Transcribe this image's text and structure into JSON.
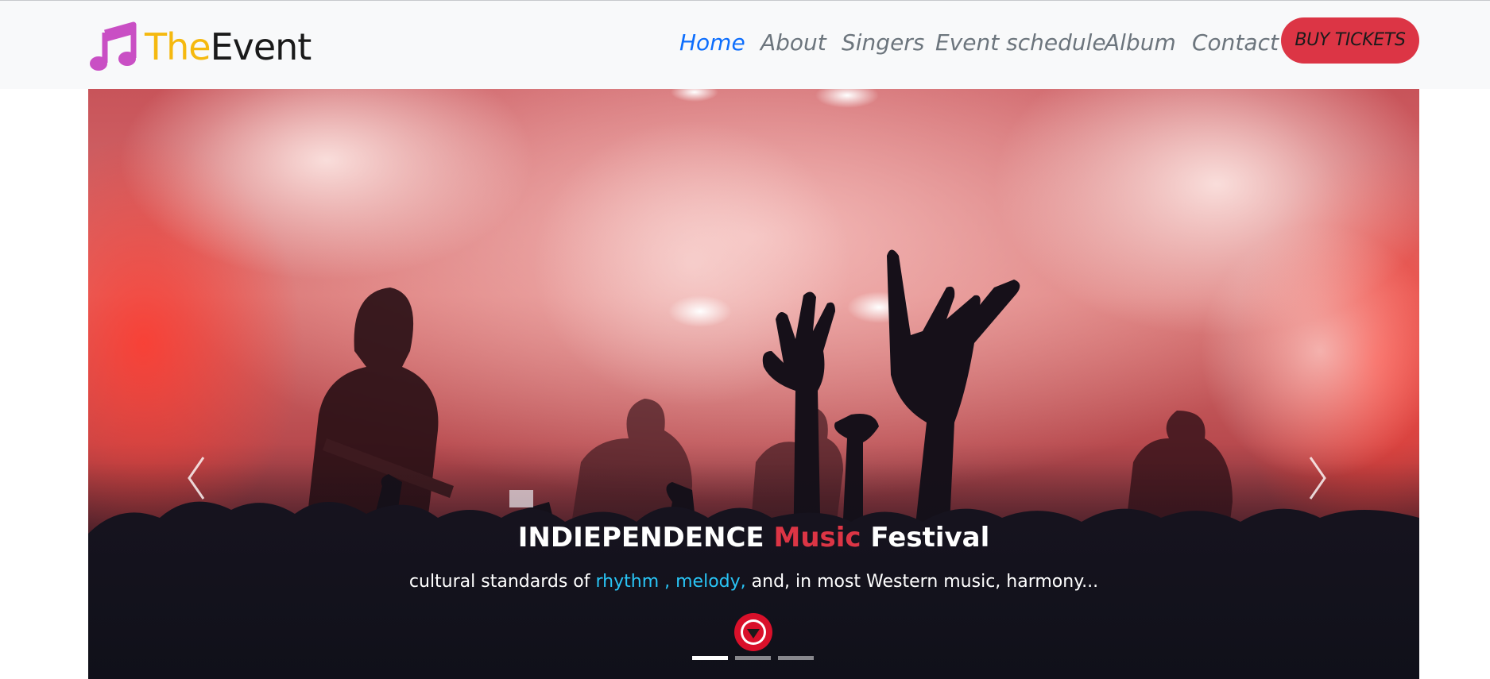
{
  "brand": {
    "part1": "The",
    "part2": "Event",
    "icon": "music-note-icon",
    "icon_color": "#c94fc4"
  },
  "nav": {
    "items": [
      {
        "label": "Home",
        "active": true
      },
      {
        "label": "About",
        "active": false
      },
      {
        "label": "Singers",
        "active": false
      },
      {
        "label": "Event schedule",
        "active": false
      },
      {
        "label": "Album",
        "active": false
      },
      {
        "label": "Contact",
        "active": false
      }
    ],
    "cta": "BUY TICKETS"
  },
  "hero": {
    "title": {
      "part1": "INDIEPENDENCE",
      "part2": "Music",
      "part3": "Festival"
    },
    "subtitle": {
      "part1": "cultural standards of",
      "part2": "rhythm , melody,",
      "part3": "and, in most Western music, harmony..."
    },
    "prev_icon": "chevron-left-icon",
    "next_icon": "chevron-right-icon",
    "scroll_icon": "triangle-down-icon",
    "slides": 3,
    "active_slide": 1
  },
  "colors": {
    "accent_red": "#dc3545",
    "link_active": "#0d6efd",
    "link": "#6c757d",
    "highlight_cyan": "#29c5f6",
    "brand_yellow": "#f5b90f"
  }
}
